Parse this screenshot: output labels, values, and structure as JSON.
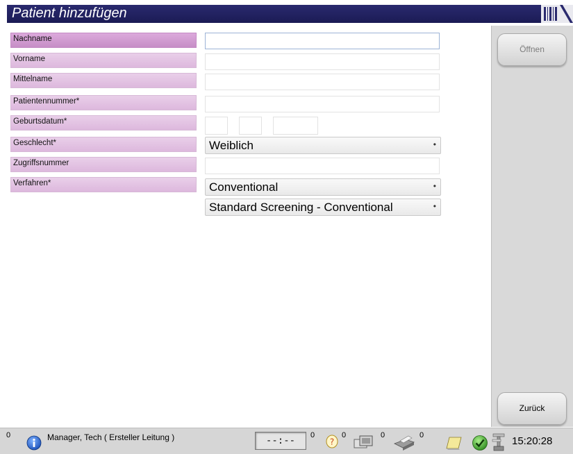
{
  "window": {
    "title": "Patient hinzufügen"
  },
  "form": {
    "fields": [
      {
        "label": "Nachname",
        "value": ""
      },
      {
        "label": "Vorname",
        "value": ""
      },
      {
        "label": "Mittelname",
        "value": ""
      },
      {
        "label": "Patientennummer*",
        "value": ""
      },
      {
        "label": "Geburtsdatum*",
        "day": "",
        "month": "",
        "year": ""
      },
      {
        "label": "Geschlecht*",
        "selected": "Weiblich"
      },
      {
        "label": "Zugriffsnummer",
        "value": ""
      },
      {
        "label": "Verfahren*",
        "selected": "Conventional",
        "selected2": "Standard Screening - Conventional"
      }
    ]
  },
  "sidebar": {
    "open_label": "Öffnen",
    "back_label": "Zurück"
  },
  "statusbar": {
    "info_count": "0",
    "user": "Manager, Tech ( Ersteller Leitung )",
    "timer": "--:--",
    "help_count": "0",
    "queue_count": "0",
    "print_count": "0",
    "archive_count": "0",
    "clock": "15:20:28"
  },
  "colors": {
    "titlebar": "#1b1b55",
    "label_bg": "#e9cfe9",
    "label_active_bg": "#c68ec6",
    "panel": "#d9d9d9"
  }
}
